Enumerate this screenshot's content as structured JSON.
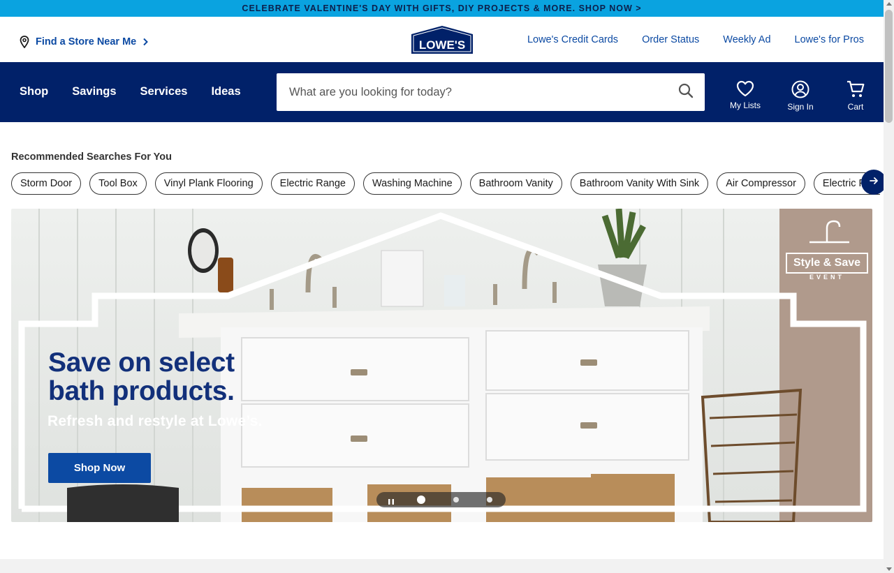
{
  "promo": {
    "text": "CELEBRATE VALENTINE'S DAY WITH GIFTS, DIY PROJECTS & MORE. SHOP NOW >"
  },
  "header": {
    "store_link": "Find a Store Near Me",
    "logo_text": "LOWE'S",
    "links": [
      "Lowe's Credit Cards",
      "Order Status",
      "Weekly Ad",
      "Lowe's for Pros"
    ]
  },
  "nav": {
    "menu": [
      "Shop",
      "Savings",
      "Services",
      "Ideas"
    ],
    "search_placeholder": "What are you looking for today?",
    "icons": {
      "lists_label": "My Lists",
      "signin_label": "Sign In",
      "cart_label": "Cart"
    }
  },
  "recommended": {
    "title": "Recommended Searches For You",
    "chips": [
      "Storm Door",
      "Tool Box",
      "Vinyl Plank Flooring",
      "Electric Range",
      "Washing Machine",
      "Bathroom Vanity",
      "Bathroom Vanity With Sink",
      "Air Compressor",
      "Electric Fireplace"
    ]
  },
  "hero": {
    "headline_line1": "Save on select",
    "headline_line2": "bath products.",
    "subtitle": "Refresh and restyle at Lowe’s.",
    "cta": "Shop Now",
    "badge_title": "Style & Save",
    "badge_sub": "EVENT",
    "carousel_active": 1,
    "carousel_count": 3
  },
  "colors": {
    "promo_bg": "#0aa3e0",
    "nav_bg": "#012169",
    "link": "#0c4aa3",
    "headline": "#12307a"
  }
}
